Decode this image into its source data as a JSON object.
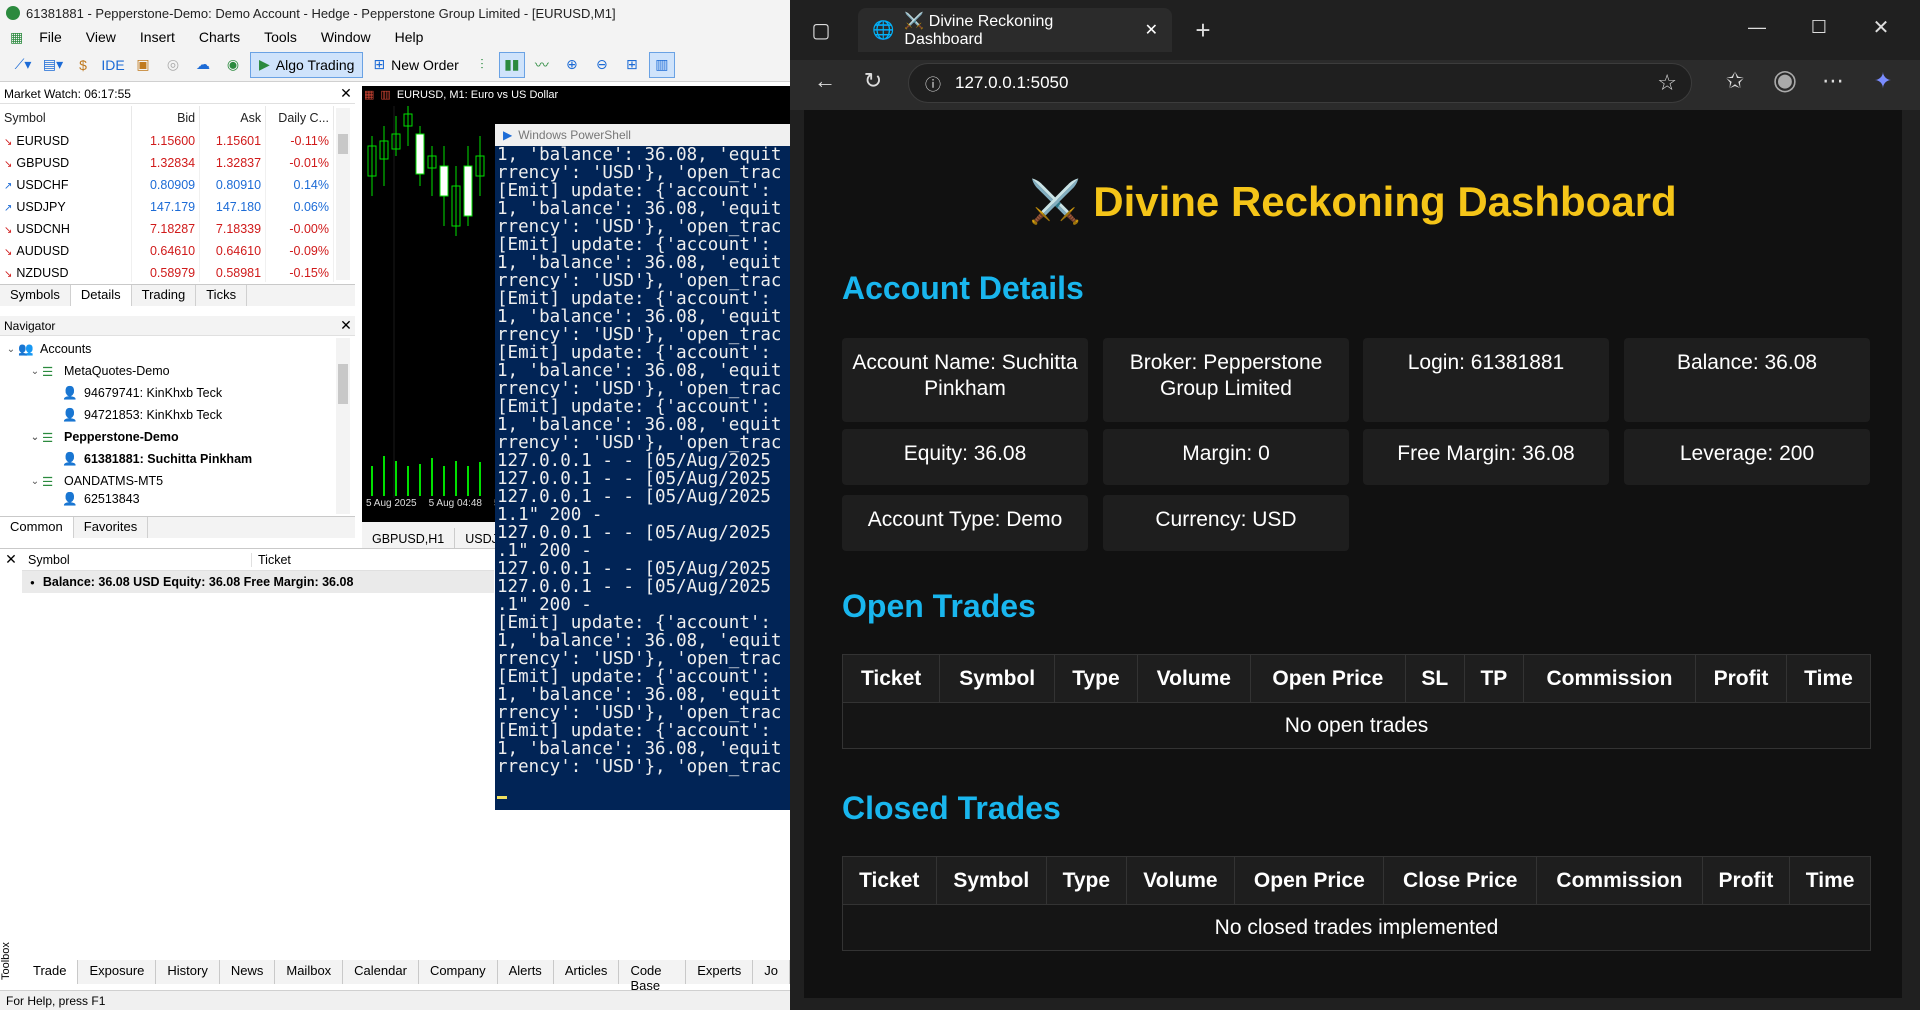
{
  "mt5": {
    "title": "61381881 - Pepperstone-Demo: Demo Account - Hedge - Pepperstone Group Limited - [EURUSD,M1]",
    "menu": [
      "File",
      "View",
      "Insert",
      "Charts",
      "Tools",
      "Window",
      "Help"
    ],
    "toolbar": {
      "ide": "IDE",
      "algo_trading": "Algo Trading",
      "new_order": "New Order"
    },
    "market_watch": {
      "title": "Market Watch: 06:17:55",
      "columns": [
        "Symbol",
        "Bid",
        "Ask",
        "Daily C..."
      ],
      "rows": [
        {
          "symbol": "EURUSD",
          "bid": "1.15600",
          "ask": "1.15601",
          "change": "-0.11%",
          "dir": "down"
        },
        {
          "symbol": "GBPUSD",
          "bid": "1.32834",
          "ask": "1.32837",
          "change": "-0.01%",
          "dir": "down"
        },
        {
          "symbol": "USDCHF",
          "bid": "0.80909",
          "ask": "0.80910",
          "change": "0.14%",
          "dir": "up"
        },
        {
          "symbol": "USDJPY",
          "bid": "147.179",
          "ask": "147.180",
          "change": "0.06%",
          "dir": "up"
        },
        {
          "symbol": "USDCNH",
          "bid": "7.18287",
          "ask": "7.18339",
          "change": "-0.00%",
          "dir": "down"
        },
        {
          "symbol": "AUDUSD",
          "bid": "0.64610",
          "ask": "0.64610",
          "change": "-0.09%",
          "dir": "down"
        },
        {
          "symbol": "NZDUSD",
          "bid": "0.58979",
          "ask": "0.58981",
          "change": "-0.15%",
          "dir": "down"
        }
      ],
      "tabs": [
        "Symbols",
        "Details",
        "Trading",
        "Ticks"
      ]
    },
    "navigator": {
      "title": "Navigator",
      "accounts": "Accounts",
      "servers": [
        {
          "name": "MetaQuotes-Demo",
          "accounts": [
            "94679741: KinKhxb Teck",
            "94721853: KinKhxb Teck"
          ]
        },
        {
          "name": "Pepperstone-Demo",
          "accounts": [
            "61381881: Suchitta Pinkham"
          ]
        },
        {
          "name": "OANDATMS-MT5",
          "accounts": [
            "62513843"
          ]
        }
      ],
      "tabs": [
        "Common",
        "Favorites"
      ]
    },
    "chart": {
      "title": "EURUSD, M1:  Euro vs US Dollar",
      "dates": [
        "5 Aug 2025",
        "5 Aug 04:48",
        "5"
      ],
      "tabs": [
        "GBPUSD,H1",
        "USDJ"
      ]
    },
    "trade": {
      "columns": [
        "Symbol",
        "Ticket"
      ],
      "summary": "Balance: 36.08 USD  Equity: 36.08  Free Margin: 36.08"
    },
    "toolbox_label": "Toolbox",
    "toolbox_tabs": [
      "Trade",
      "Exposure",
      "History",
      "News",
      "Mailbox",
      "Calendar",
      "Company",
      "Alerts",
      "Articles",
      "Code Base",
      "Experts",
      "Jo"
    ],
    "status": "For Help, press F1"
  },
  "powershell": {
    "title": "Windows PowerShell",
    "lines": [
      "1, 'balance': 36.08, 'equit",
      "rrency': 'USD'}, 'open_trac",
      "[Emit] update: {'account':",
      "1, 'balance': 36.08, 'equit",
      "rrency': 'USD'}, 'open_trac",
      "[Emit] update: {'account':",
      "1, 'balance': 36.08, 'equit",
      "rrency': 'USD'}, 'open_trac",
      "[Emit] update: {'account':",
      "1, 'balance': 36.08, 'equit",
      "rrency': 'USD'}, 'open_trac",
      "[Emit] update: {'account':",
      "1, 'balance': 36.08, 'equit",
      "rrency': 'USD'}, 'open_trac",
      "[Emit] update: {'account':",
      "1, 'balance': 36.08, 'equit",
      "rrency': 'USD'}, 'open_trac",
      "127.0.0.1 - - [05/Aug/2025",
      "127.0.0.1 - - [05/Aug/2025",
      "127.0.0.1 - - [05/Aug/2025",
      "1.1\" 200 -",
      "127.0.0.1 - - [05/Aug/2025",
      ".1\" 200 -",
      "127.0.0.1 - - [05/Aug/2025",
      "127.0.0.1 - - [05/Aug/2025",
      ".1\" 200 -",
      "[Emit] update: {'account':",
      "1, 'balance': 36.08, 'equit",
      "rrency': 'USD'}, 'open_trac",
      "[Emit] update: {'account':",
      "1, 'balance': 36.08, 'equit",
      "rrency': 'USD'}, 'open_trac",
      "[Emit] update: {'account':",
      "1, 'balance': 36.08, 'equit",
      "rrency': 'USD'}, 'open_trac"
    ]
  },
  "browser": {
    "tab_title": "⚔️ Divine Reckoning Dashboard",
    "url": "127.0.0.1:5050"
  },
  "dashboard": {
    "title": "⚔️ Divine Reckoning Dashboard",
    "account_heading": "Account Details",
    "cards": [
      "Account Name: Suchitta Pinkham",
      "Broker: Pepperstone Group Limited",
      "Login: 61381881",
      "Balance: 36.08",
      "Equity: 36.08",
      "Margin: 0",
      "Free Margin: 36.08",
      "Leverage: 200",
      "Account Type: Demo",
      "Currency: USD"
    ],
    "open_heading": "Open Trades",
    "open_columns": [
      "Ticket",
      "Symbol",
      "Type",
      "Volume",
      "Open Price",
      "SL",
      "TP",
      "Commission",
      "Profit",
      "Time"
    ],
    "open_empty": "No open trades",
    "closed_heading": "Closed Trades",
    "closed_columns": [
      "Ticket",
      "Symbol",
      "Type",
      "Volume",
      "Open Price",
      "Close Price",
      "Commission",
      "Profit",
      "Time"
    ],
    "closed_empty": "No closed trades implemented"
  },
  "colors": {
    "accent_gold": "#f5c518",
    "accent_cyan": "#19b6ee",
    "down": "#d01a1a",
    "up": "#1c6bd6"
  }
}
